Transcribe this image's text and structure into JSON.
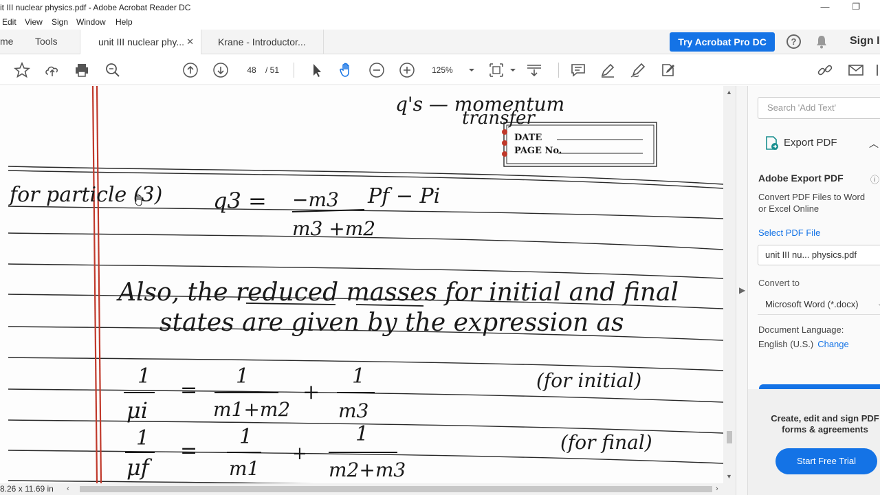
{
  "window": {
    "title": "it III nuclear physics.pdf - Adobe Acrobat Reader DC",
    "minimize": "—",
    "maximize": "❐"
  },
  "menu": {
    "items": [
      "Edit",
      "View",
      "Sign",
      "Window",
      "Help"
    ]
  },
  "tabs": {
    "home": "me",
    "tools": "Tools",
    "documents": [
      {
        "label": "unit III nuclear phy...",
        "active": true
      },
      {
        "label": "Krane - Introductor...",
        "active": false
      }
    ]
  },
  "header": {
    "try_pro": "Try Acrobat Pro DC",
    "sign_in": "Sign I"
  },
  "toolbar": {
    "current_page": "48",
    "total_pages": "/ 51",
    "zoom": "125%"
  },
  "document": {
    "page_size": "8.26 x 11.69 in",
    "handwriting": {
      "top_note_1": "q's — momentum",
      "top_note_2": "transfer",
      "date_label": "DATE",
      "page_no_label": "PAGE No.",
      "line_particle": "for particle (3)",
      "q3": "q3 =",
      "m3_num": "−m3",
      "pf_pi": "Pf  − Pi",
      "m3m2_den": "m3 +m2",
      "also_line": "Also, the reduced masses for initial and final",
      "states_line": "states are given by the expression as",
      "one": "1",
      "mu_i": "μi",
      "eq1": "=",
      "m1m2": "m1+m2",
      "plus": "+",
      "m3": "m3",
      "for_initial": "(for initial)",
      "mu_f": "μf",
      "eq2": "=",
      "m1": "m1",
      "m2m3": "m2+m3",
      "for_final": "(for final)"
    }
  },
  "right_pane": {
    "search_placeholder": "Search 'Add Text'",
    "export_pdf": "Export PDF",
    "adobe_export_title": "Adobe Export PDF",
    "convert_desc": "Convert PDF Files to Word or Excel Online",
    "select_pdf": "Select PDF File",
    "file_name": "unit III nu... physics.pdf",
    "convert_to": "Convert to",
    "format": "Microsoft Word (*.docx)",
    "doc_language": "Document Language:",
    "language": "English (U.S.)",
    "change": "Change",
    "promo_text": "Create, edit and sign PDF forms & agreements",
    "free_trial": "Start Free Trial"
  },
  "colors": {
    "accent": "#1473e6",
    "margin_red": "#c0392b",
    "ink": "#1a1a1a"
  }
}
